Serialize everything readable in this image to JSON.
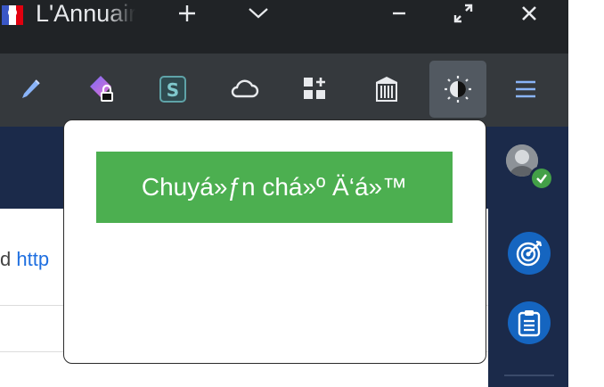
{
  "titlebar": {
    "tab_title": "L'Annuaire",
    "new_tab_icon": "plus-icon",
    "tab_list_icon": "chevron-down-icon",
    "minimize_icon": "minimize-icon",
    "restore_icon": "restore-icon",
    "close_icon": "close-icon"
  },
  "toolbar": {
    "extensions": [
      {
        "name": "pen-icon"
      },
      {
        "name": "lock-extension-icon"
      },
      {
        "name": "stylus-s-icon"
      },
      {
        "name": "cloud-icon"
      },
      {
        "name": "apps-add-icon"
      },
      {
        "name": "archive-icon"
      },
      {
        "name": "dark-mode-icon",
        "active": true
      }
    ],
    "menu_icon": "hamburger-menu-icon"
  },
  "page": {
    "text_prefix": "d ",
    "link_text": "http"
  },
  "popup": {
    "button_label": "Chuyá»ƒn chá»º Ä‘á»™"
  },
  "sidebar": {
    "avatar_icon": "avatar-icon",
    "status_icon": "check-badge-icon",
    "items": [
      {
        "name": "target-icon"
      },
      {
        "name": "clipboard-icon"
      }
    ]
  },
  "colors": {
    "titlebar_bg": "#202326",
    "toolbar_bg": "#35393d",
    "active_tool_bg": "#525961",
    "page_header_bg": "#1b2a4a",
    "popup_button_bg": "#4caf50",
    "sidebar_icon_bg": "#1565c0",
    "status_badge": "#43a047",
    "link": "#1f6fe0"
  }
}
